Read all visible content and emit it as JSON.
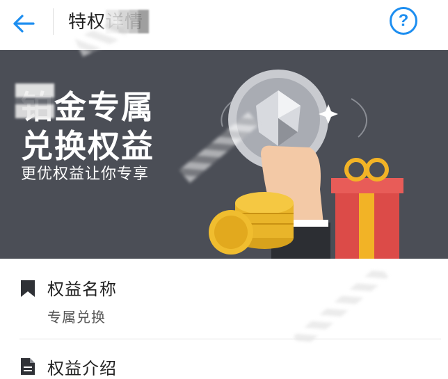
{
  "header": {
    "back_icon": "arrow-left-icon",
    "title": "特权详情",
    "help_icon": "question-circle-icon",
    "accent_color": "#1d8ef0"
  },
  "banner": {
    "headline_line1": "铂金专属",
    "headline_line2": "兑换权益",
    "subline": "更优权益让你专享",
    "background_color": "#4b4e56"
  },
  "sections": [
    {
      "icon": "bookmark-icon",
      "title": "权益名称",
      "value": "专属兑换"
    },
    {
      "icon": "document-icon",
      "title": "权益介绍"
    }
  ]
}
